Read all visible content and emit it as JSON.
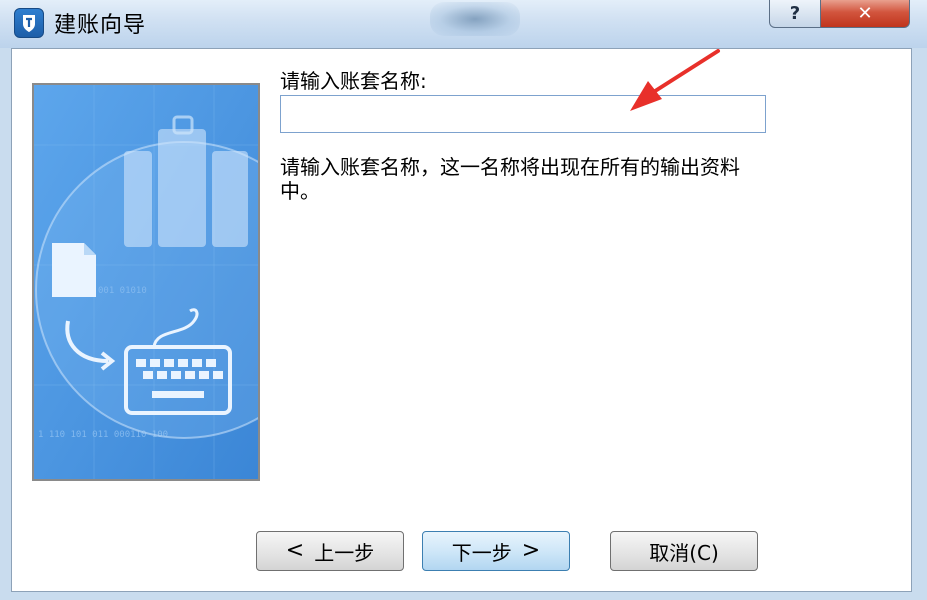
{
  "window": {
    "title": "建账向导",
    "help_glyph": "?",
    "close_glyph": "✕"
  },
  "form": {
    "label": "请输入账套名称:",
    "input_value": "",
    "description": "请输入账套名称，这一名称将出现在所有的输出资料中。"
  },
  "buttons": {
    "prev": {
      "chevron": "<",
      "label": "上一步"
    },
    "next": {
      "label": "下一步",
      "chevron": ">"
    },
    "cancel": {
      "label": "取消(C)"
    }
  },
  "banner": {
    "binary_text": [
      "1 110 101 011 000110 100",
      "001 01010"
    ]
  },
  "colors": {
    "annotation_arrow": "#e8302a",
    "banner_blue": "#4f98e2",
    "input_border": "#7da2ce",
    "close_red": "#c7422a"
  }
}
